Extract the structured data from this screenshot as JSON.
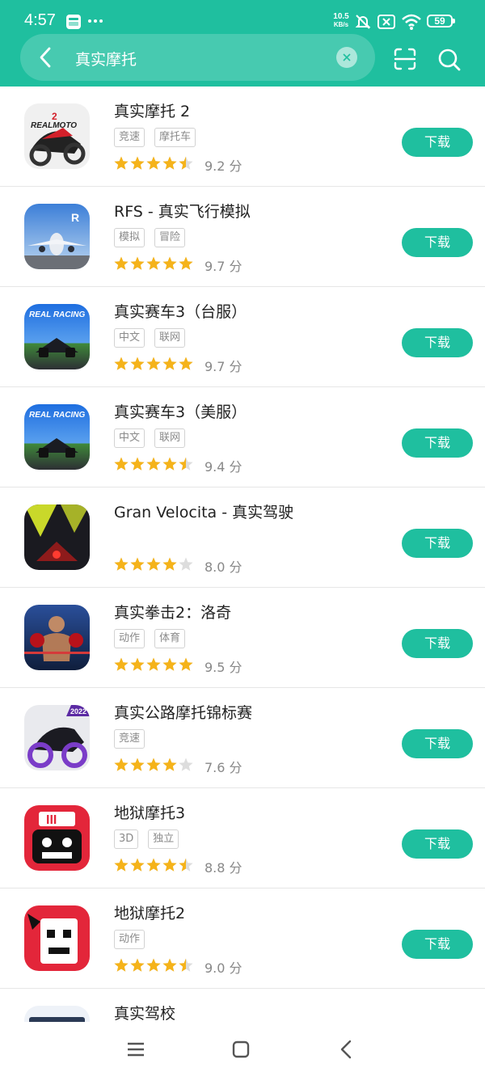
{
  "status_bar": {
    "time": "4:57",
    "net_speed_value": "10.5",
    "net_speed_unit": "KB/s",
    "battery": "59",
    "icons": [
      "app-notification-icon",
      "more-dots-icon",
      "mute-bell-icon",
      "no-sim-icon",
      "wifi-icon",
      "battery-icon"
    ]
  },
  "search": {
    "query": "真实摩托"
  },
  "colors": {
    "accent": "#1fbf9f",
    "star": "#f5b31a",
    "star_empty": "#dddddd"
  },
  "results": [
    {
      "name": "真实摩托 2",
      "tags": [
        "竞速",
        "摩托车"
      ],
      "rating": 4.5,
      "score": "9.2 分",
      "button": "下载",
      "icon": "real-moto-2-icon"
    },
    {
      "name": "RFS - 真实飞行模拟",
      "tags": [
        "模拟",
        "冒险"
      ],
      "rating": 5,
      "score": "9.7 分",
      "button": "下载",
      "icon": "rfs-flight-icon"
    },
    {
      "name": "真实赛车3（台服）",
      "tags": [
        "中文",
        "联网"
      ],
      "rating": 5,
      "score": "9.7 分",
      "button": "下载",
      "icon": "real-racing-3-icon",
      "icon_text": "REAL RACING"
    },
    {
      "name": "真实赛车3（美服）",
      "tags": [
        "中文",
        "联网"
      ],
      "rating": 4.5,
      "score": "9.4 分",
      "button": "下载",
      "icon": "real-racing-3-icon",
      "icon_text": "REAL RACING"
    },
    {
      "name": "Gran Velocita - 真实驾驶",
      "tags": [],
      "rating": 4,
      "score": "8.0 分",
      "button": "下载",
      "icon": "gran-velocita-icon"
    },
    {
      "name": "真实拳击2：洛奇",
      "tags": [
        "动作",
        "体育"
      ],
      "rating": 5,
      "score": "9.5 分",
      "button": "下载",
      "icon": "boxing-icon"
    },
    {
      "name": "真实公路摩托锦标赛",
      "tags": [
        "竞速"
      ],
      "rating": 4,
      "score": "7.6 分",
      "button": "下载",
      "icon": "road-moto-icon",
      "icon_text": "2022"
    },
    {
      "name": "地狱摩托3",
      "tags": [
        "3D",
        "独立"
      ],
      "rating": 4.5,
      "score": "8.8 分",
      "button": "下载",
      "icon": "hell-moto-3-icon",
      "icon_text": "III"
    },
    {
      "name": "地狱摩托2",
      "tags": [
        "动作"
      ],
      "rating": 4.5,
      "score": "9.0 分",
      "button": "下载",
      "icon": "hell-moto-2-icon"
    },
    {
      "name": "真实驾校",
      "tags": [],
      "rating": null,
      "score": "",
      "button": "",
      "icon": "driving-school-icon"
    }
  ]
}
